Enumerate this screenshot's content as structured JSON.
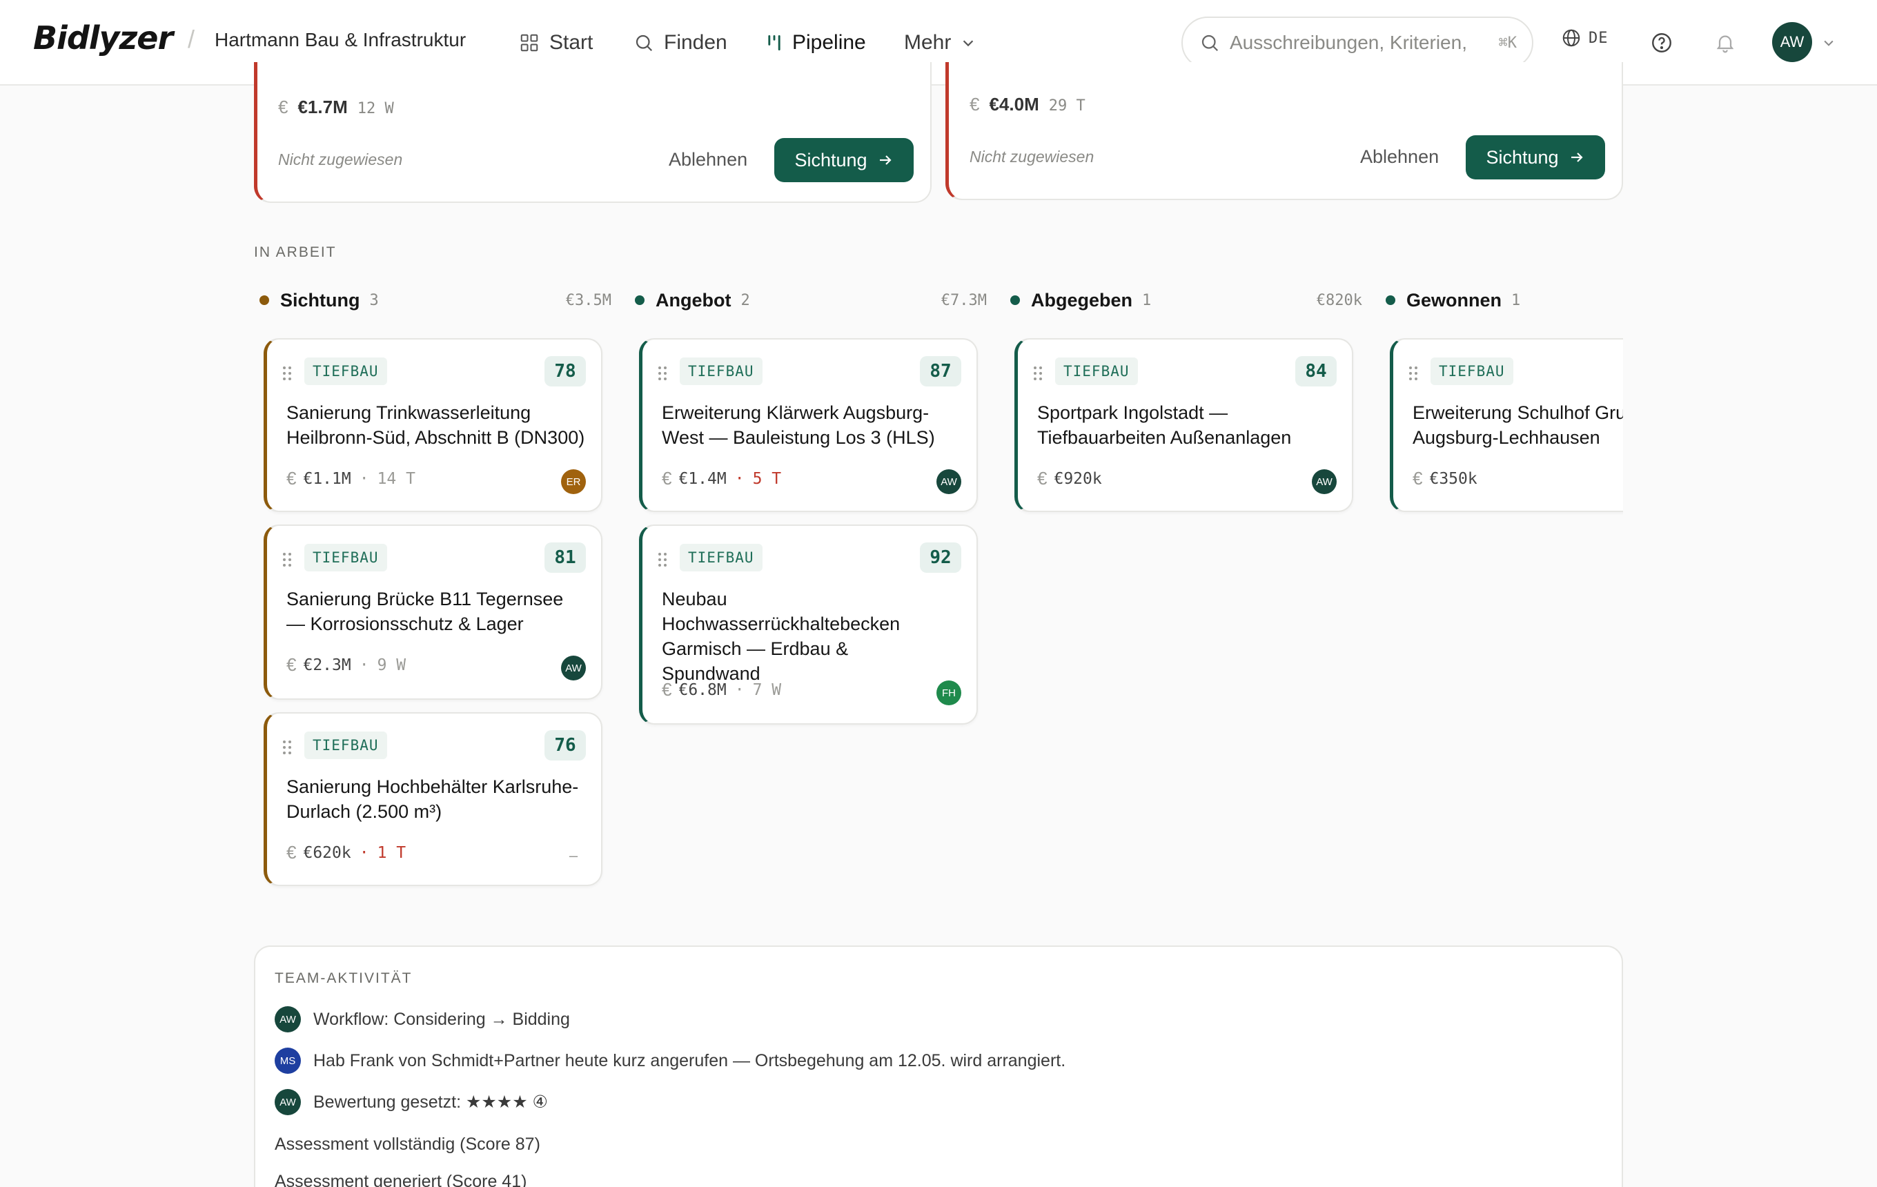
{
  "header": {
    "logo": "Bidlyzer",
    "separator": "/",
    "company": "Hartmann Bau & Infrastruktur",
    "nav": [
      {
        "label": "Start",
        "icon": "grid-icon"
      },
      {
        "label": "Finden",
        "icon": "search-icon"
      },
      {
        "label": "Pipeline",
        "icon": "pipeline-icon",
        "active": true
      },
      {
        "label": "Mehr",
        "icon": "chevron-down-icon"
      }
    ],
    "search_placeholder": "Ausschreibungen, Kriterien,",
    "search_shortcut": "⌘K",
    "language": "DE",
    "user_initials": "AW"
  },
  "top_cards": [
    {
      "amount": "€1.7M",
      "duration": "12 W",
      "assignee": "Nicht zugewiesen",
      "reject_label": "Ablehnen",
      "review_label": "Sichtung"
    },
    {
      "amount": "€4.0M",
      "duration": "29 T",
      "assignee": "Nicht zugewiesen",
      "reject_label": "Ablehnen",
      "review_label": "Sichtung"
    }
  ],
  "section_label": "IN ARBEIT",
  "columns": [
    {
      "name": "Sichtung",
      "count": "3",
      "sum": "€3.5M",
      "color": "#8c5a0c",
      "cards": [
        {
          "tag": "TIEFBAU",
          "score": "78",
          "title": "Sanierung Trinkwasserleitung Heilbronn-Süd, Abschnitt B (DN300)",
          "amount": "€1.1M",
          "deadline": "14 T",
          "urgent": false,
          "assignee": "ER",
          "assignee_color": "#a0620e"
        },
        {
          "tag": "TIEFBAU",
          "score": "81",
          "title": "Sanierung Brücke B11 Tegernsee — Korrosionsschutz & Lager",
          "amount": "€2.3M",
          "deadline": "9 W",
          "urgent": false,
          "assignee": "AW",
          "assignee_color": "#17473c"
        },
        {
          "tag": "TIEFBAU",
          "score": "76",
          "title": "Sanierung Hochbehälter Karlsruhe-Durlach (2.500 m³)",
          "amount": "€620k",
          "deadline": "1 T",
          "urgent": true,
          "assignee": "–",
          "assignee_color": ""
        }
      ]
    },
    {
      "name": "Angebot",
      "count": "2",
      "sum": "€7.3M",
      "color": "#145c4a",
      "cards": [
        {
          "tag": "TIEFBAU",
          "score": "87",
          "title": "Erweiterung Klärwerk Augsburg-West — Bauleistung Los 3 (HLS)",
          "amount": "€1.4M",
          "deadline": "5 T",
          "urgent": true,
          "assignee": "AW",
          "assignee_color": "#17473c"
        },
        {
          "tag": "TIEFBAU",
          "score": "92",
          "title": "Neubau Hochwasserrückhaltebecken Garmisch — Erdbau & Spundwand",
          "amount": "€6.8M",
          "deadline": "7 W",
          "urgent": false,
          "assignee": "FH",
          "assignee_color": "#1f8a4c"
        }
      ]
    },
    {
      "name": "Abgegeben",
      "count": "1",
      "sum": "€820k",
      "color": "#145c4a",
      "cards": [
        {
          "tag": "TIEFBAU",
          "score": "84",
          "title": "Sportpark Ingolstadt — Tiefbauarbeiten Außenanlagen",
          "amount": "€920k",
          "deadline": "",
          "urgent": false,
          "assignee": "AW",
          "assignee_color": "#17473c"
        }
      ]
    },
    {
      "name": "Gewonnen",
      "count": "1",
      "sum": "",
      "color": "#145c4a",
      "cards": [
        {
          "tag": "TIEFBAU",
          "score": "",
          "title": "Erweiterung Schulhof Grun Augsburg-Lechhausen",
          "amount": "€350k",
          "deadline": "",
          "urgent": false,
          "assignee": "",
          "assignee_color": ""
        }
      ]
    }
  ],
  "activity": {
    "label": "TEAM-AKTIVITÄT",
    "items": [
      {
        "initials": "AW",
        "color": "#17473c",
        "text": "Workflow: Considering → Bidding"
      },
      {
        "initials": "MS",
        "color": "#1e3fa0",
        "text": "Hab Frank von Schmidt+Partner heute kurz angerufen — Ortsbegehung am 12.05. wird arrangiert."
      },
      {
        "initials": "AW",
        "color": "#17473c",
        "text": "Bewertung gesetzt: ★★★★ ④"
      },
      {
        "initials": "",
        "color": "",
        "text": "Assessment vollständig (Score 87)"
      },
      {
        "initials": "",
        "color": "",
        "text": "Assessment generiert (Score 41)"
      }
    ]
  }
}
